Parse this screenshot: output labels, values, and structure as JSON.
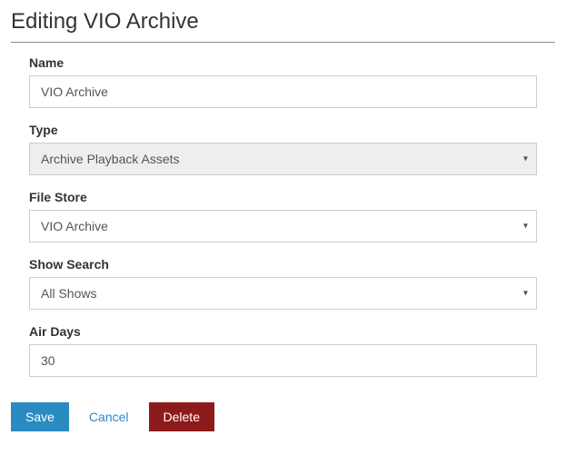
{
  "title": "Editing VIO Archive",
  "fields": {
    "name": {
      "label": "Name",
      "value": "VIO Archive"
    },
    "type": {
      "label": "Type",
      "value": "Archive Playback Assets"
    },
    "file_store": {
      "label": "File Store",
      "value": "VIO Archive"
    },
    "show_search": {
      "label": "Show Search",
      "value": "All Shows"
    },
    "air_days": {
      "label": "Air Days",
      "value": "30"
    }
  },
  "buttons": {
    "save": "Save",
    "cancel": "Cancel",
    "delete": "Delete"
  }
}
